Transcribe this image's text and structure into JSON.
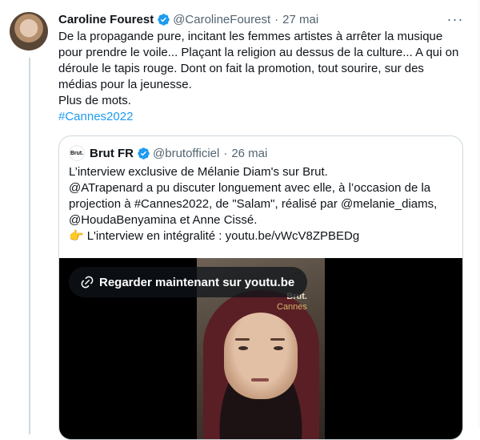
{
  "tweet": {
    "author_name": "Caroline Fourest",
    "author_handle": "@CarolineFourest",
    "separator": "·",
    "date": "27 mai",
    "more_label": "···",
    "text_lines": [
      "De la propagande pure, incitant les femmes artistes à arrêter la musique",
      "pour prendre le voile... Plaçant la religion au dessus de la culture... A qui on",
      "déroule le tapis rouge. Dont on fait la promotion, tout sourire, sur des",
      "médias pour la jeunesse.",
      "Plus de mots."
    ],
    "hashtag": "#Cannes2022"
  },
  "quote": {
    "logo_text": "Brut.",
    "author_name": "Brut FR",
    "author_handle": "@brutofficiel",
    "separator": "·",
    "date": "26 mai",
    "text_lines": [
      "L’interview exclusive de Mélanie Diam's sur Brut.",
      "@ATrapenard a pu discuter longuement avec elle, à l’occasion de la",
      "projection à #Cannes2022, de \"Salam\", réalisé par @melanie_diams,",
      "@HoudaBenyamina et Anne Cissé."
    ],
    "emoji": "👉",
    "link_line": "L'interview en intégralité : youtu.be/vWcV8ZPBEDg",
    "media": {
      "watch_label": "Regarder maintenant sur youtu.be",
      "brand_top": "Brut.",
      "brand_bottom": "Cannes"
    }
  },
  "colors": {
    "accent": "#1d9bf0",
    "secondary_text": "#536471",
    "border": "#cfd9de"
  },
  "icons": [
    "verified-badge-icon",
    "more-icon",
    "link-icon"
  ]
}
